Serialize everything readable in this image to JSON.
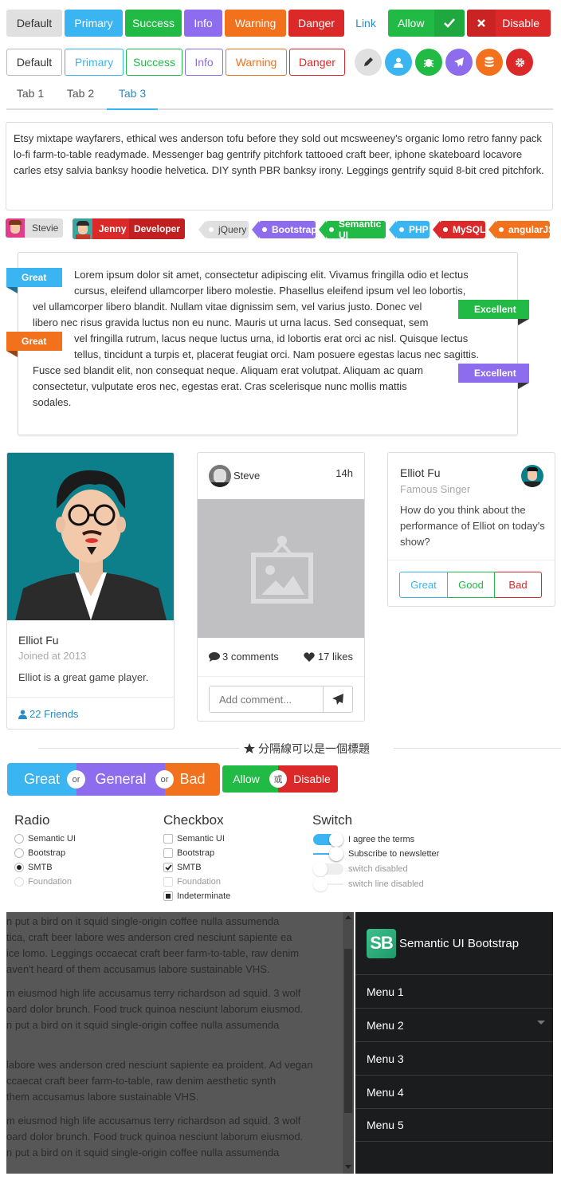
{
  "buttons_row1": [
    {
      "label": "Default",
      "bg": "#e0e0e0",
      "fg": "#333"
    },
    {
      "label": "Primary",
      "bg": "#3bb4f2"
    },
    {
      "label": "Success",
      "bg": "#21ba45"
    },
    {
      "label": "Info",
      "bg": "#8e6cee"
    },
    {
      "label": "Warning",
      "bg": "#f2711c"
    },
    {
      "label": "Danger",
      "bg": "#db2828"
    }
  ],
  "link_label": "Link",
  "allow_label": "Allow",
  "disable_label": "Disable",
  "buttons_row2": [
    "Default",
    "Primary",
    "Success",
    "Info",
    "Warning",
    "Danger"
  ],
  "circle_icons": [
    {
      "icon": "pencil-icon",
      "bg": "#e0e0e0",
      "fg": "#333"
    },
    {
      "icon": "user-icon",
      "bg": "#3bb4f2"
    },
    {
      "icon": "bug-icon",
      "bg": "#21ba45"
    },
    {
      "icon": "plane-icon",
      "bg": "#8e6cee"
    },
    {
      "icon": "database-icon",
      "bg": "#f2711c"
    },
    {
      "icon": "gear-icon",
      "bg": "#db2828"
    }
  ],
  "tabs": [
    "Tab 1",
    "Tab 2",
    "Tab 3"
  ],
  "active_tab": 2,
  "paragraph": "Etsy mixtape wayfarers, ethical wes anderson tofu before they sold out mcsweeney's organic lomo retro fanny pack lo-fi farm-to-table readymade. Messenger bag gentrify pitchfork tattooed craft beer, iphone skateboard locavore carles etsy salvia banksy hoodie helvetica. DIY synth PBR banksy irony. Leggings gentrify squid 8-bit cred pitchfork.",
  "user_labels": {
    "stevie": "Stevie",
    "jenny": "Jenny",
    "jenny_detail": "Developer"
  },
  "tags": [
    "jQuery",
    "Bootstrap",
    "Semantic UI",
    "PHP",
    "MySQL",
    "angularJS"
  ],
  "ribbons": {
    "great1": "Great",
    "great2": "Great",
    "excellent1": "Excellent",
    "excellent2": "Excellent"
  },
  "ribbon_text": [
    "Lorem ipsum dolor sit amet, consectetur adipiscing elit. Vivamus fringilla odio et lectus",
    "cursus, eleifend ullamcorper libero molestie. Phasellus eleifend ipsum vel leo lobortis,",
    "vel ullamcorper libero blandit. Nullam vitae dignissim sem, vel varius justo. Donec vel",
    "libero nec risus gravida luctus non eu nunc. Mauris ut urna lacus. Sed consequat, sem",
    "vel fringilla rutrum, lacus neque luctus urna, id lobortis erat orci ac nisl. Quisque lectus",
    "tellus, tincidunt a turpis et, placerat feugiat orci. Nam posuere egestas lacus nec sagittis.",
    "Fusce sed blandit elit, non consequat neque. Aliquam erat volutpat. Aliquam ac quam",
    "consectetur, vulputate eros nec, egestas erat. Cras scelerisque nunc mollis mattis",
    "sodales."
  ],
  "profile": {
    "name": "Elliot Fu",
    "meta": "Joined at 2013",
    "desc": "Elliot is a great game player.",
    "friends": "22 Friends"
  },
  "post": {
    "user": "Steve",
    "time": "14h",
    "comments": "3 comments",
    "likes": "17 likes",
    "placeholder": "Add comment..."
  },
  "question": {
    "name": "Elliot Fu",
    "meta": "Famous Singer",
    "text": "How do you think about the performance of Elliot on today's show?",
    "opts": [
      "Great",
      "Good",
      "Bad"
    ]
  },
  "divider_title": "分隔線可以是一個標題",
  "rating": {
    "great": "Great",
    "general": "General",
    "bad": "Bad",
    "or": "or",
    "allow": "Allow",
    "disable": "Disable",
    "huo": "或"
  },
  "radio": {
    "title": "Radio",
    "items": [
      "Semantic UI",
      "Bootstrap",
      "SMTB",
      "Foundation"
    ]
  },
  "checkbox": {
    "title": "Checkbox",
    "items": [
      "Semantic UI",
      "Bootstrap",
      "SMTB",
      "Foundation",
      "Indeterminate"
    ]
  },
  "switch": {
    "title": "Switch",
    "items": [
      "I agree the terms",
      "Subscribe to newsletter",
      "switch disabled",
      "switch line disabled"
    ]
  },
  "dark_paragraphs": [
    [
      "n put a bird on it squid single-origin coffee nulla assumenda",
      "tica, craft beer labore wes anderson cred nesciunt sapiente ea",
      "ice lomo. Leggings occaecat craft beer farm-to-table, raw denim",
      "aven't heard of them accusamus labore sustainable VHS."
    ],
    [
      "m eiusmod high life accusamus terry richardson ad squid. 3 wolf",
      "oard dolor brunch. Food truck quinoa nesciunt laborum eiusmod.",
      "n put a bird on it squid single-origin coffee nulla assumenda"
    ],
    [
      "labore wes anderson cred nesciunt sapiente ea proident. Ad vegan",
      "ccaecat craft beer farm-to-table, raw denim aesthetic synth",
      "them accusamus labore sustainable VHS."
    ],
    [
      "m eiusmod high life accusamus terry richardson ad squid. 3 wolf",
      "oard dolor brunch. Food truck quinoa nesciunt laborum eiusmod.",
      "n put a bird on it squid single-origin coffee nulla assumenda"
    ]
  ],
  "sidebar": {
    "logo": "SB",
    "title": "Semantic UI Bootstrap",
    "menu": [
      "Menu 1",
      "Menu 2",
      "Menu 3",
      "Menu 4",
      "Menu 5"
    ]
  }
}
